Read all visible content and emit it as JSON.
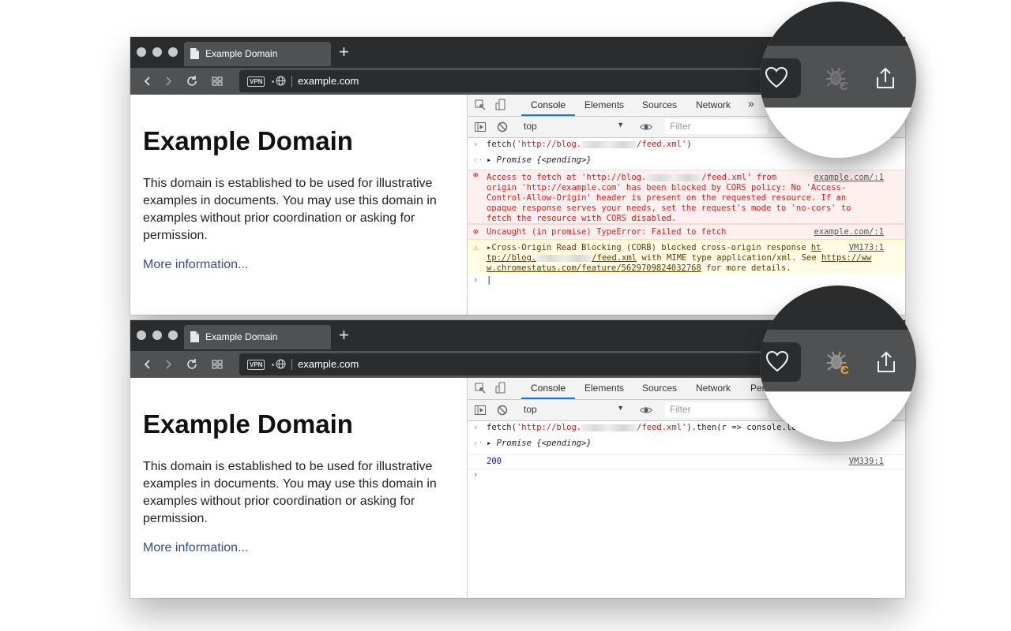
{
  "browser": {
    "tab_title": "Example Domain",
    "new_tab_symbol": "+",
    "vpn_badge": "VPN",
    "url": "example.com"
  },
  "page": {
    "heading": "Example Domain",
    "paragraph": "This domain is established to be used for illustrative examples in documents. You may use this domain in examples without prior coordination or asking for permission.",
    "link": "More information..."
  },
  "devtools": {
    "tabs_top": [
      "Console",
      "Elements",
      "Sources",
      "Network",
      "»"
    ],
    "tabs_bottom": [
      "Console",
      "Elements",
      "Sources",
      "Network",
      "Per"
    ],
    "context": "top",
    "filter_placeholder": "Filter",
    "accent_color": "#1a73e8"
  },
  "console_top": {
    "cmd_prefix": "fetch(",
    "cmd_str_a": "'http://blog.",
    "cmd_str_b": "/feed.xml'",
    "cmd_suffix": ")",
    "promise": "Promise {<pending>}",
    "error1_lines": [
      "Access to fetch at 'http://blog.",
      "/feed.xml' from",
      "origin 'http://example.com' has been blocked by CORS policy: No 'Access-",
      "Control-Allow-Origin' header is present on the requested resource. If an",
      "opaque response serves your needs, set the request's mode to 'no-cors' to",
      "fetch the resource with CORS disabled."
    ],
    "error1_source": "example.com/:1",
    "error2": "Uncaught (in promise) TypeError: Failed to fetch",
    "error2_source": "example.com/:1",
    "warning_lines": [
      "Cross-Origin Read Blocking (CORB) blocked cross-origin response ",
      "ht",
      "tp://blog.",
      "/feed.xml",
      " with MIME type application/xml. See ",
      "https://ww",
      "w.chromestatus.com/feature/5629709824032768",
      " for more details."
    ],
    "warning_source": "VM173:1"
  },
  "console_bottom": {
    "cmd_prefix": "fetch(",
    "cmd_str_a": "'http://blog.",
    "cmd_str_b": "/feed.xml'",
    "cmd_suffix": ").then(r => console.lo",
    "promise": "Promise {<pending>}",
    "output": "200",
    "output_source": "VM339:1"
  },
  "icons": {
    "heart": "heart-icon",
    "extension": "cors-extension-icon",
    "share": "share-icon",
    "extension_active_color": "#f5a623"
  }
}
